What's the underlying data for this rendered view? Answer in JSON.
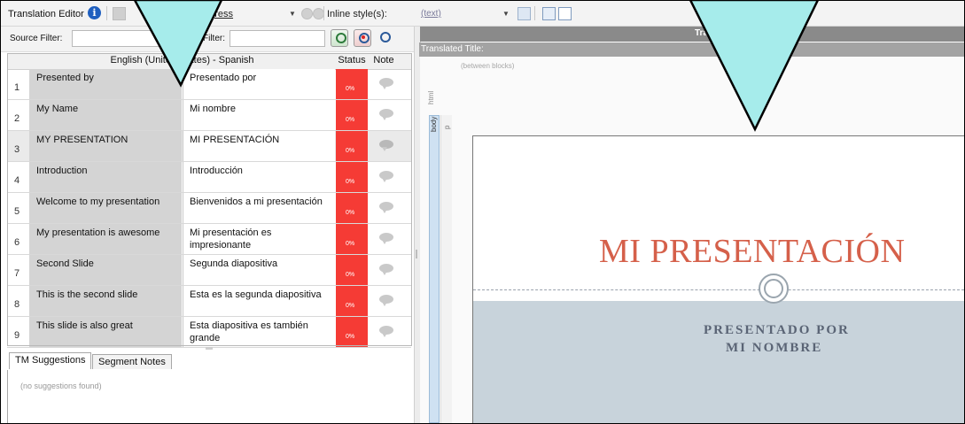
{
  "toolbar": {
    "title": "Translation Editor",
    "progress_label": "Progress",
    "inline_styles_label": "Inline style(s):",
    "inline_styles_value": "(text)"
  },
  "filters": {
    "source_label": "Source Filter:",
    "target_label": "Filter:"
  },
  "grid": {
    "columns": {
      "language": "English (United States) - Spanish",
      "status": "Status",
      "note": "Note"
    },
    "rows": [
      {
        "num": "1",
        "source": "Presented by",
        "target": "Presentado por",
        "status": "0%"
      },
      {
        "num": "2",
        "source": "My Name",
        "target": "Mi nombre",
        "status": "0%"
      },
      {
        "num": "3",
        "source": "MY PRESENTATION",
        "target": "MI PRESENTACIÓN",
        "status": "0%"
      },
      {
        "num": "4",
        "source": "Introduction",
        "target": "Introducción",
        "status": "0%"
      },
      {
        "num": "5",
        "source": "Welcome to my presentation",
        "target": "Bienvenidos a mi presentación",
        "status": "0%"
      },
      {
        "num": "6",
        "source": "My presentation is awesome",
        "target": "Mi presentación es impresionante",
        "status": "0%"
      },
      {
        "num": "7",
        "source": "Second Slide",
        "target": "Segunda diapositiva",
        "status": "0%"
      },
      {
        "num": "8",
        "source": "This is the second slide",
        "target": "Esta es la segunda diapositiva",
        "status": "0%"
      },
      {
        "num": "9",
        "source": "This slide is also great",
        "target": "Esta diapositiva es también grande",
        "status": "0%"
      }
    ]
  },
  "bottom_tabs": {
    "tm_suggestions": "TM Suggestions",
    "segment_notes": "Segment Notes",
    "empty_message": "(no suggestions found)"
  },
  "preview": {
    "header_text": "Transla",
    "translated_title_label": "Translated Title:",
    "between_blocks": "(between blocks)",
    "html_tag": "html",
    "body_tag": "body",
    "p_tag": "p",
    "slide_title": "MI PRESENTACIÓN",
    "subtitle_line1": "PRESENTADO POR",
    "subtitle_line2": "MI NOMBRE"
  },
  "colors": {
    "status_untranslated": "#f53b35",
    "callout_fill": "#a6eceb",
    "slide_title": "#d5604a",
    "slide_band": "#c8d3db"
  }
}
